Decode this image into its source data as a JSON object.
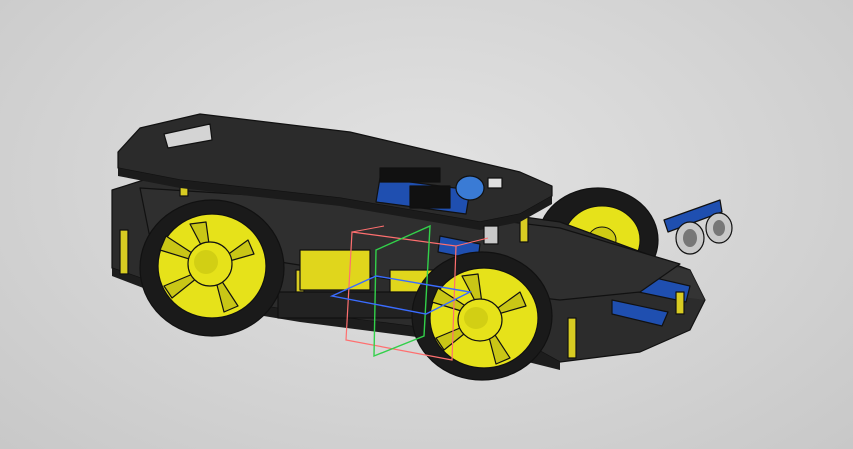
{
  "viewport": {
    "background_color": "#d4d4d4"
  },
  "model": {
    "chassis_color": "#2a2a2a",
    "wheel_color": "#e6e21a",
    "tire_color": "#1c1c1c",
    "standoff_color": "#d8cc22",
    "board_color": "#1f4fb0",
    "sensor_color": "#c9c9c9"
  },
  "selection_gizmo": {
    "box_color": "#ff6f6f",
    "x_axis_color": "#3a6cff",
    "y_axis_color": "#32d04a"
  }
}
